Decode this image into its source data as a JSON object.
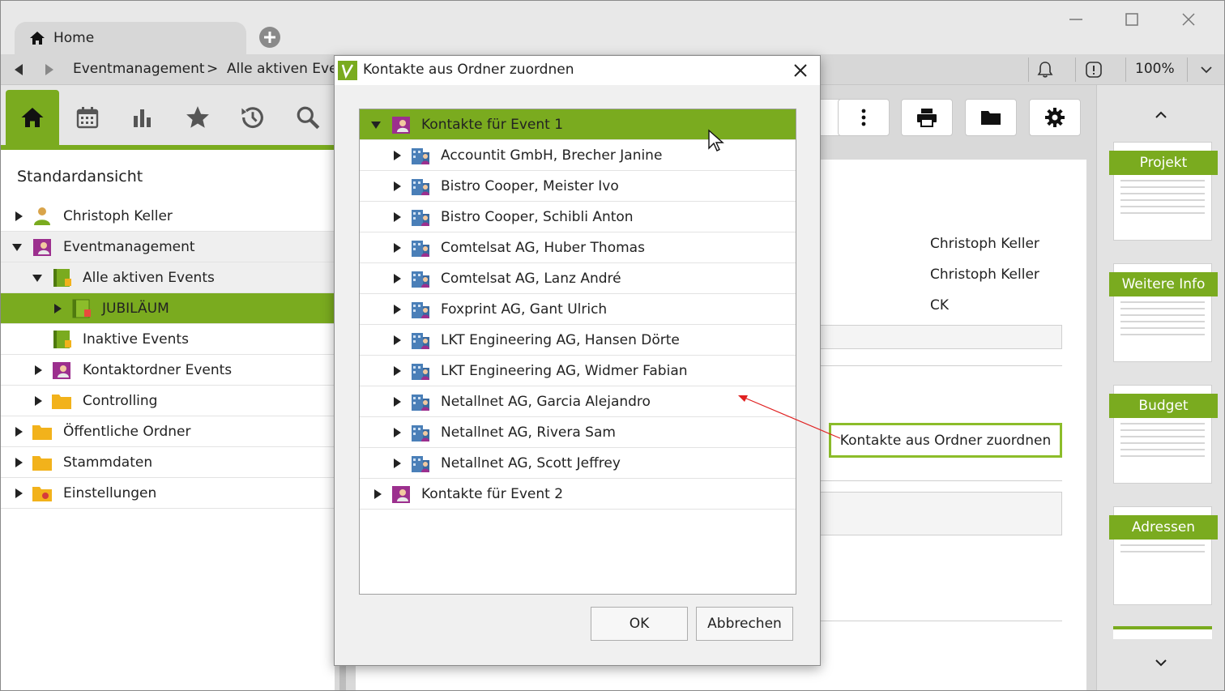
{
  "tabs": {
    "home_label": "Home"
  },
  "addressbar": {
    "crumbs": [
      "Eventmanagement",
      ">",
      "Alle aktiven Even"
    ],
    "zoom": "100%"
  },
  "leftpanel": {
    "view_title": "Standardansicht",
    "tree": [
      "Christoph Keller",
      "Eventmanagement",
      "Alle aktiven Events",
      "JUBILÄUM",
      "Inaktive Events",
      "Kontaktordner Events",
      "Controlling",
      "Öffentliche Ordner",
      "Stammdaten",
      "Einstellungen"
    ]
  },
  "main": {
    "info_lines": [
      "Christoph Keller",
      "Christoph Keller",
      "CK"
    ],
    "callout_label": "Kontakte aus Ordner zuordnen"
  },
  "rightpanel": {
    "thumbnails": [
      "Projekt",
      "Weitere Info",
      "Budget",
      "Adressen"
    ]
  },
  "dialog": {
    "title": "Kontakte aus Ordner zuordnen",
    "root": "Kontakte für Event 1",
    "contacts": [
      "Accountit GmbH, Brecher Janine",
      "Bistro Cooper, Meister Ivo",
      "Bistro Cooper, Schibli Anton",
      "Comtelsat AG, Huber Thomas",
      "Comtelsat AG, Lanz André",
      "Foxprint AG, Gant Ulrich",
      "LKT Engineering AG, Hansen Dörte",
      "LKT Engineering AG, Widmer Fabian",
      "Netallnet AG, Garcia Alejandro",
      "Netallnet AG, Rivera Sam",
      "Netallnet AG, Scott Jeffrey"
    ],
    "root2": "Kontakte für Event 2",
    "ok_label": "OK",
    "cancel_label": "Abbrechen"
  },
  "colors": {
    "accent": "#7aab1f",
    "folder": "#f2b21b",
    "contact_purple": "#9c2f8e",
    "contact_blue": "#4a7fb8"
  }
}
